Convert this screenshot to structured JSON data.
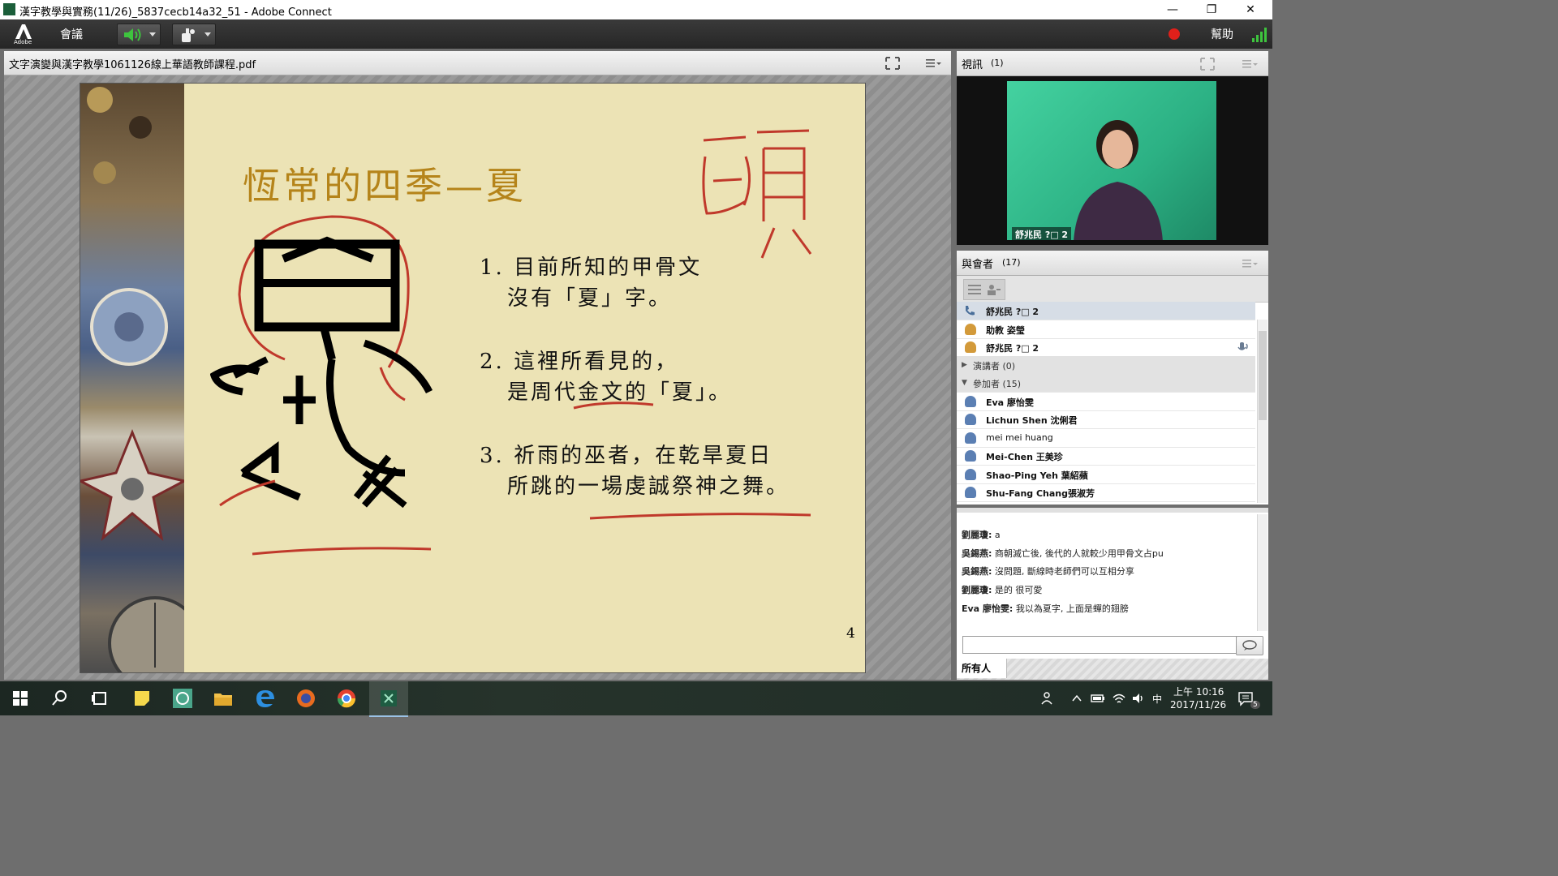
{
  "window": {
    "title": "漢字教學與實務(11/26)_5837cecb14a32_51 - Adobe Connect",
    "minimize": "—",
    "maximize": "❐",
    "close": "✕"
  },
  "menubar": {
    "logo_text": "Adobe",
    "meeting_label": "會議",
    "help_label": "幫助"
  },
  "share_pod": {
    "file_name": "文字演變與漢字教學1061126線上華語教師課程.pdf",
    "slide": {
      "title": "恆常的四季—夏",
      "point1_line1": "1. 目前所知的甲骨文",
      "point1_line2": "沒有「夏」字。",
      "point2_line1": "2. 這裡所看見的，",
      "point2_line2": "是周代金文的「夏」。",
      "point3_line1": "3. 祈雨的巫者，在乾旱夏日",
      "point3_line2": "所跳的一場虔誠祭神之舞。",
      "page_number": "4"
    }
  },
  "video_pod": {
    "title": "視訊",
    "count": "(1)",
    "caption": "舒兆民 ?□ 2"
  },
  "attendees_pod": {
    "title": "與會者",
    "count": "(17)",
    "host_line": "舒兆民 ?□ 2",
    "hosts": [
      {
        "name": "助教 姿瑩"
      },
      {
        "name": "舒兆民 ?□ 2"
      }
    ],
    "presenters_group": "演講者 (0)",
    "participants_group": "參加者 (15)",
    "participants": [
      {
        "name": "Eva 廖怡雯"
      },
      {
        "name": "Lichun Shen 沈俐君"
      },
      {
        "name": "mei mei huang"
      },
      {
        "name": "Mei-Chen 王美珍"
      },
      {
        "name": "Shao-Ping Yeh 葉紹蘋"
      },
      {
        "name": "Shu-Fang Chang張淑芳"
      }
    ]
  },
  "chat_pod": {
    "messages": [
      {
        "sender": "劉麗瓊:",
        "text": "a"
      },
      {
        "sender": "吳錫燕:",
        "text": "商朝滅亡後, 後代的人就較少用甲骨文占pu"
      },
      {
        "sender": "吳錫燕:",
        "text": "沒問題, 斷線時老師們可以互相分享"
      },
      {
        "sender": "劉麗瓊:",
        "text": "是的 很可愛"
      },
      {
        "sender": "Eva 廖怡雯:",
        "text": "我以為夏字, 上面是蟬的翅膀"
      }
    ],
    "input_value": "",
    "recipient_tab": "所有人"
  },
  "taskbar": {
    "time": "上午 10:16",
    "date": "2017/11/26",
    "ime": "中",
    "notifications": "5"
  },
  "colors": {
    "slide_bg": "#ece3b5",
    "slide_title": "#b5841a",
    "annotation_red": "#c0392b",
    "record_red": "#e0201a",
    "signal_green": "#3ec43e"
  }
}
